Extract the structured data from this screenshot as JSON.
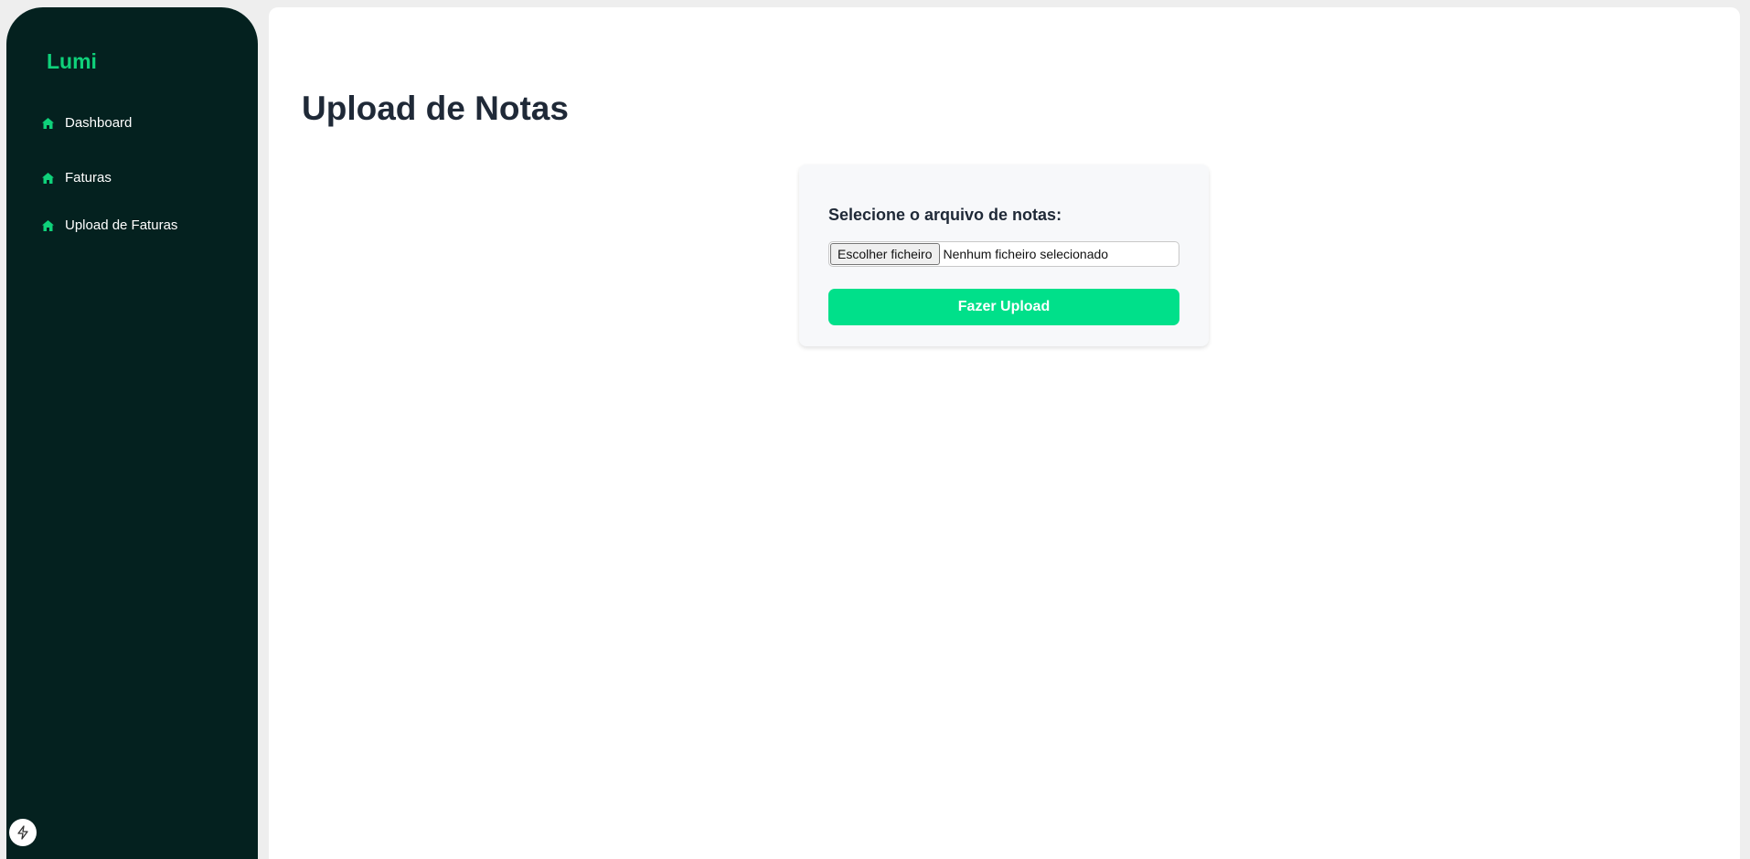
{
  "colors": {
    "sidebar_bg": "#04211f",
    "accent": "#0fd17a",
    "button": "#00e08a"
  },
  "sidebar": {
    "logo": "Lumi",
    "items": [
      {
        "label": "Dashboard",
        "icon": "home-icon"
      },
      {
        "label": "Faturas",
        "icon": "home-icon"
      },
      {
        "label": "Upload de Faturas",
        "icon": "home-icon"
      }
    ],
    "bottom_icon": "bolt-icon"
  },
  "main": {
    "title": "Upload de Notas",
    "form": {
      "label": "Selecione o arquivo de notas:",
      "file_button": "Escolher ficheiro",
      "file_status": "Nenhum ficheiro selecionado",
      "submit": "Fazer Upload"
    }
  }
}
